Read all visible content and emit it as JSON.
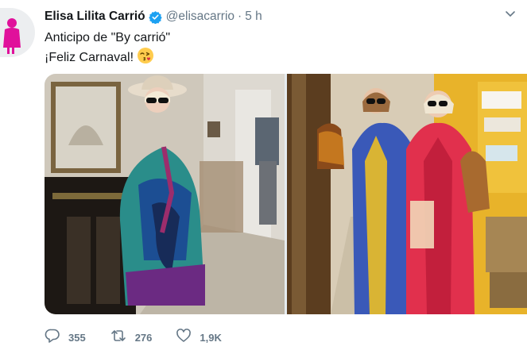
{
  "tweet": {
    "author_name": "Elisa Lilita Carrió",
    "handle": "@elisacarrio",
    "separator": "·",
    "time": "5 h",
    "text_line1": "Anticipo de \"By carrió\"",
    "text_line2": "¡Feliz Carnaval!",
    "emoji": "face-blowing-kiss-icon"
  },
  "actions": {
    "replies": "355",
    "retweets": "276",
    "likes": "1,9K"
  },
  "colors": {
    "avatar_figure": "#e0119b",
    "verified": "#1da1f2",
    "muted_text": "#657786"
  }
}
